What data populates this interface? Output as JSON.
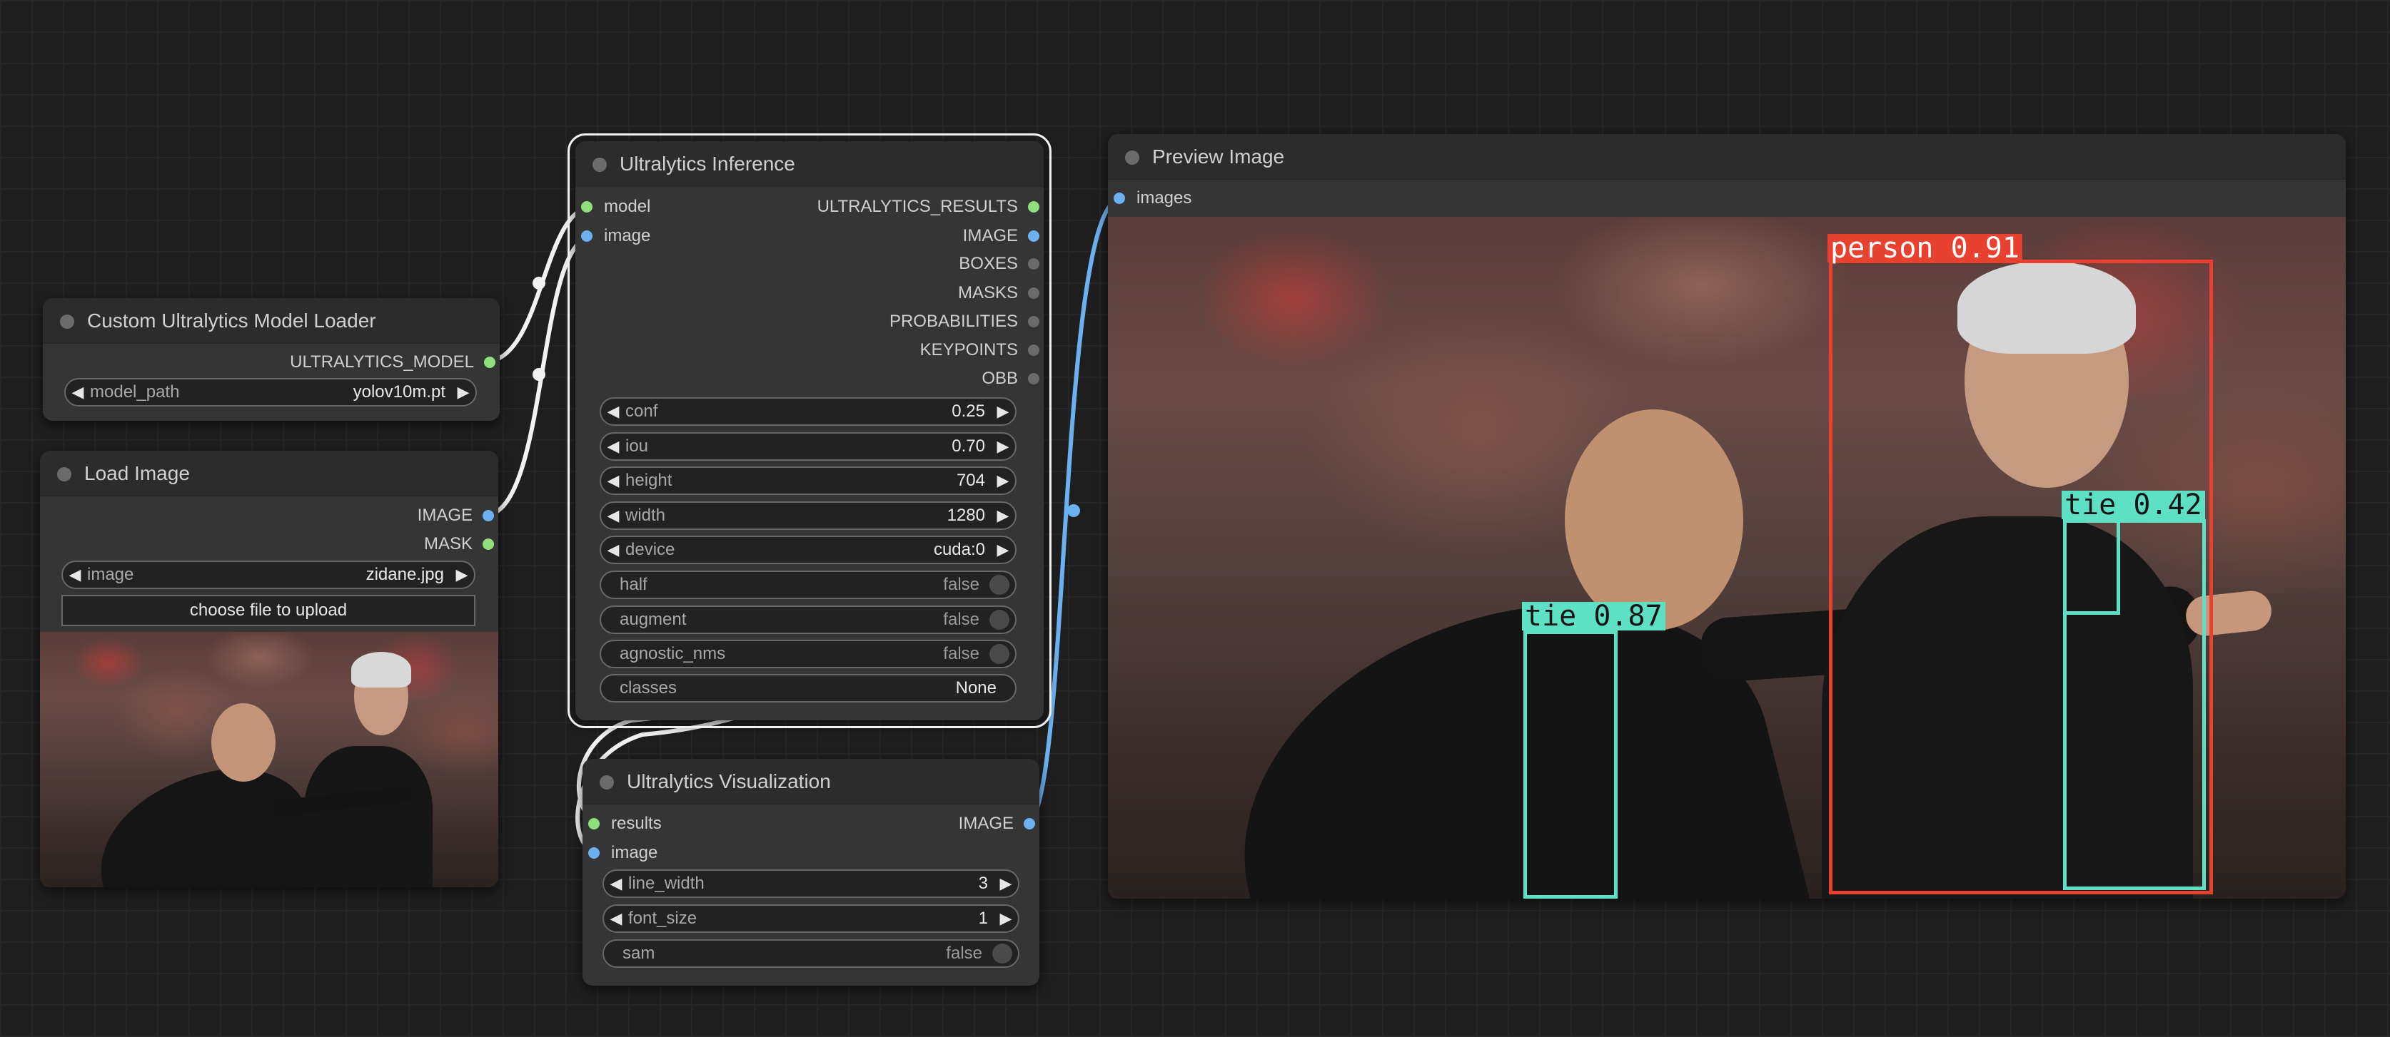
{
  "nodes": {
    "model_loader": {
      "title": "Custom Ultralytics Model Loader",
      "outputs": [
        "ULTRALYTICS_MODEL"
      ],
      "widgets": {
        "model_path": {
          "label": "model_path",
          "value": "yolov10m.pt"
        }
      }
    },
    "load_image": {
      "title": "Load Image",
      "outputs": [
        "IMAGE",
        "MASK"
      ],
      "widgets": {
        "image": {
          "label": "image",
          "value": "zidane.jpg"
        }
      },
      "upload_button": "choose file to upload"
    },
    "inference": {
      "title": "Ultralytics Inference",
      "inputs": [
        "model",
        "image"
      ],
      "outputs": [
        "ULTRALYTICS_RESULTS",
        "IMAGE",
        "BOXES",
        "MASKS",
        "PROBABILITIES",
        "KEYPOINTS",
        "OBB"
      ],
      "widgets": {
        "conf": {
          "label": "conf",
          "value": "0.25"
        },
        "iou": {
          "label": "iou",
          "value": "0.70"
        },
        "height": {
          "label": "height",
          "value": "704"
        },
        "width": {
          "label": "width",
          "value": "1280"
        },
        "device": {
          "label": "device",
          "value": "cuda:0"
        },
        "half": {
          "label": "half",
          "value": "false"
        },
        "augment": {
          "label": "augment",
          "value": "false"
        },
        "agnostic_nms": {
          "label": "agnostic_nms",
          "value": "false"
        },
        "classes": {
          "label": "classes",
          "value": "None"
        }
      }
    },
    "visualization": {
      "title": "Ultralytics Visualization",
      "inputs": [
        "results",
        "image"
      ],
      "outputs": [
        "IMAGE"
      ],
      "widgets": {
        "line_width": {
          "label": "line_width",
          "value": "3"
        },
        "font_size": {
          "label": "font_size",
          "value": "1"
        },
        "sam": {
          "label": "sam",
          "value": "false"
        }
      }
    },
    "preview": {
      "title": "Preview Image",
      "inputs": [
        "images"
      ],
      "detections": [
        {
          "label": "person 0.91",
          "cls": "person",
          "conf": 0.91,
          "color": "#e8412f"
        },
        {
          "label": "tie 0.42",
          "cls": "tie",
          "conf": 0.42,
          "color": "#5ee0c4"
        },
        {
          "label": "tie 0.87",
          "cls": "tie",
          "conf": 0.87,
          "color": "#5ee0c4"
        }
      ]
    }
  },
  "colors": {
    "canvas": "#1e1e1e",
    "node_bg": "#353535",
    "model_link": "#8fe07a",
    "image_link": "#6bb0f0",
    "white_link": "#f2f2f2"
  },
  "icons": [
    "arrow-left-icon",
    "arrow-right-icon",
    "node-collapse-dot-icon",
    "toggle-knob-icon"
  ]
}
